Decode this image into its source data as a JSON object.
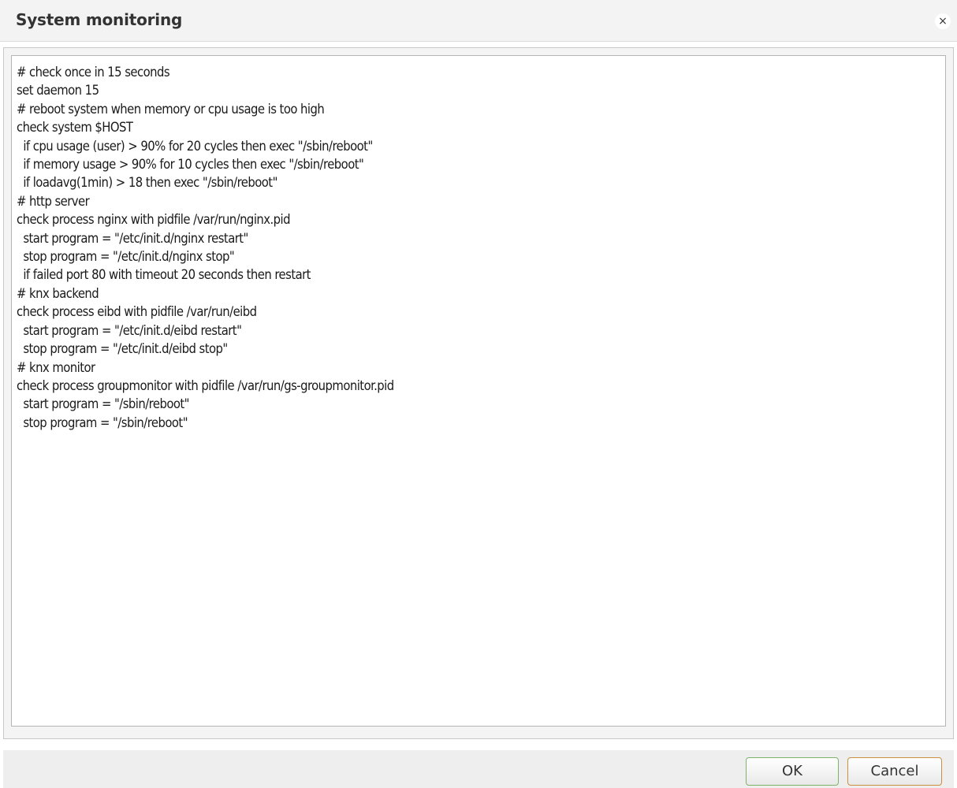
{
  "dialog": {
    "title": "System monitoring",
    "close_label": "×"
  },
  "editor": {
    "content": "# check once in 15 seconds\nset daemon 15\n# reboot system when memory or cpu usage is too high\ncheck system $HOST\n  if cpu usage (user) > 90% for 20 cycles then exec \"/sbin/reboot\"\n  if memory usage > 90% for 10 cycles then exec \"/sbin/reboot\"\n  if loadavg(1min) > 18 then exec \"/sbin/reboot\"\n# http server\ncheck process nginx with pidfile /var/run/nginx.pid\n  start program = \"/etc/init.d/nginx restart\"\n  stop program = \"/etc/init.d/nginx stop\"\n  if failed port 80 with timeout 20 seconds then restart\n# knx backend\ncheck process eibd with pidfile /var/run/eibd\n  start program = \"/etc/init.d/eibd restart\"\n  stop program = \"/etc/init.d/eibd stop\"\n# knx monitor\ncheck process groupmonitor with pidfile /var/run/gs-groupmonitor.pid\n  start program = \"/sbin/reboot\"\n  stop program = \"/sbin/reboot\""
  },
  "footer": {
    "ok_label": "OK",
    "cancel_label": "Cancel"
  },
  "colors": {
    "ok_border": "#7fb36a",
    "cancel_border": "#c8913f",
    "titlebar_bg": "#f3f3f3"
  },
  "icons": {
    "close": "close-icon"
  }
}
